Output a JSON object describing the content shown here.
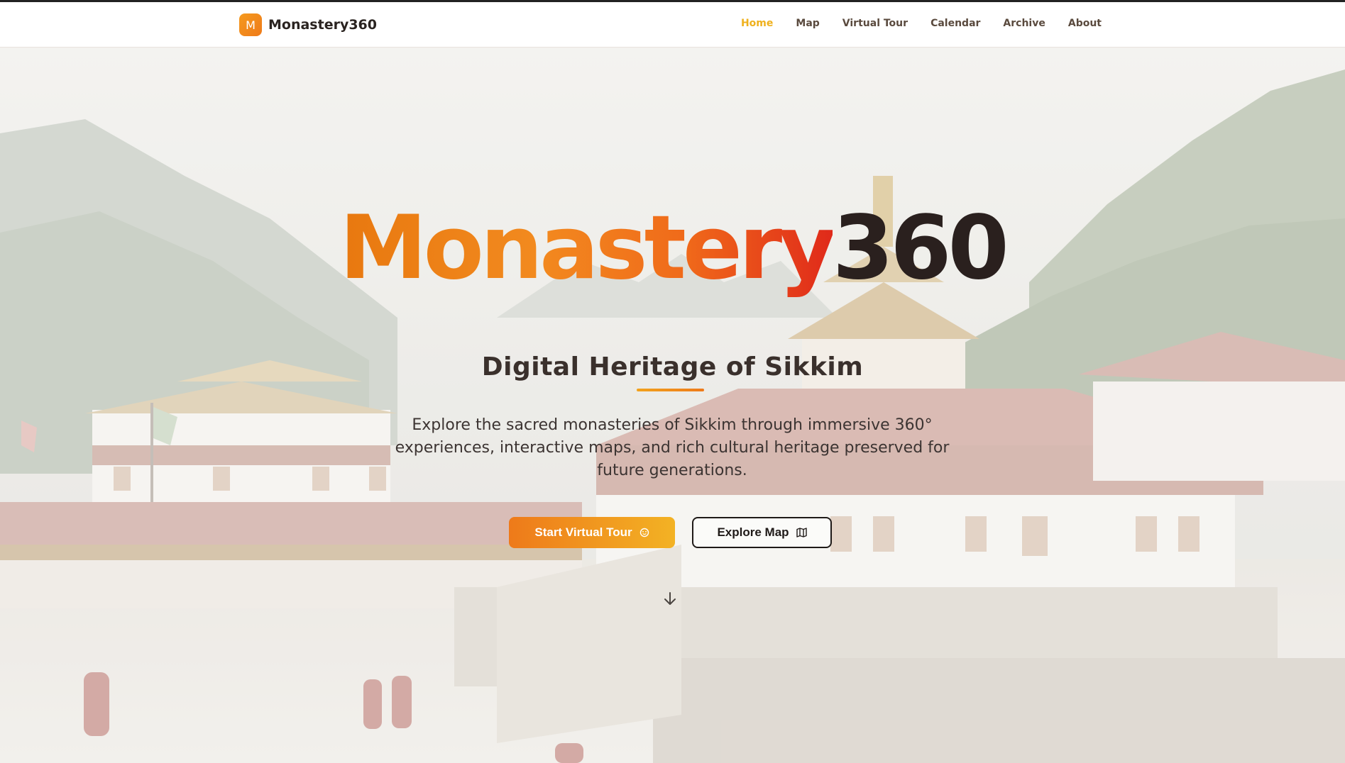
{
  "nav": {
    "brand_initial": "M",
    "brand_name": "Monastery360",
    "links": [
      "Home",
      "Map",
      "Virtual Tour",
      "Calendar",
      "Archive",
      "About"
    ],
    "active": "Home"
  },
  "hero": {
    "title_part1": "Monastery",
    "title_part2": "360",
    "subtitle": "Digital Heritage of Sikkim",
    "description": "Explore the sacred monasteries of Sikkim through immersive 360° experiences, interactive maps, and rich cultural heritage preserved for future generations.",
    "primary_button": {
      "label": "Start Virtual Tour",
      "icon": "compass-icon"
    },
    "secondary_button": {
      "label": "Explore Map",
      "icon": "map-icon"
    },
    "scroll_icon": "arrow-down-icon"
  },
  "colors": {
    "accent_orange": "#ee7a1a",
    "accent_gold": "#efb11d",
    "title_red": "#e02a1a",
    "dark_text": "#2a201e"
  }
}
